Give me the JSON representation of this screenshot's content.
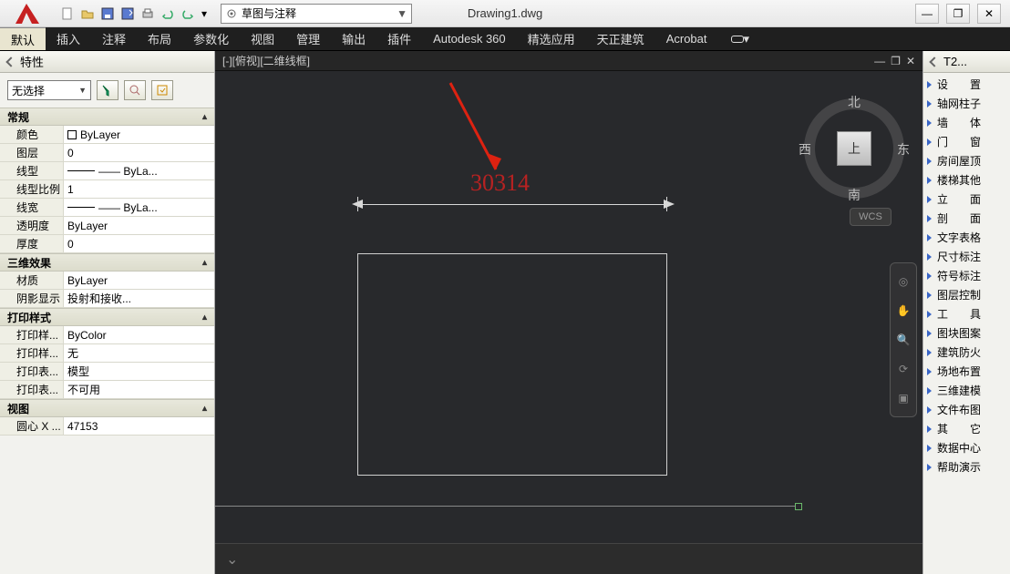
{
  "titlebar": {
    "doc": "Drawing1.dwg"
  },
  "qat_icons": [
    "new",
    "open",
    "save",
    "saveas",
    "plot",
    "undo",
    "redo"
  ],
  "workspace": {
    "label": "草图与注释"
  },
  "win": {
    "min": "—",
    "max": "❐",
    "close": "✕"
  },
  "menus": [
    "默认",
    "插入",
    "注释",
    "布局",
    "参数化",
    "视图",
    "管理",
    "输出",
    "插件",
    "Autodesk 360",
    "精选应用",
    "天正建筑",
    "Acrobat"
  ],
  "props": {
    "panel_title": "特性",
    "selection": "无选择",
    "sections": [
      {
        "name": "常规",
        "rows": [
          {
            "k": "颜色",
            "v": "ByLayer",
            "swatch": true
          },
          {
            "k": "图层",
            "v": "0"
          },
          {
            "k": "线型",
            "v": "—— ByLa...",
            "line": true
          },
          {
            "k": "线型比例",
            "v": "1"
          },
          {
            "k": "线宽",
            "v": "—— ByLa...",
            "line": true
          },
          {
            "k": "透明度",
            "v": "ByLayer"
          },
          {
            "k": "厚度",
            "v": "0"
          }
        ]
      },
      {
        "name": "三维效果",
        "rows": [
          {
            "k": "材质",
            "v": "ByLayer"
          },
          {
            "k": "阴影显示",
            "v": "投射和接收..."
          }
        ]
      },
      {
        "name": "打印样式",
        "rows": [
          {
            "k": "打印样...",
            "v": "ByColor"
          },
          {
            "k": "打印样...",
            "v": "无"
          },
          {
            "k": "打印表...",
            "v": "模型"
          },
          {
            "k": "打印表...",
            "v": "不可用"
          }
        ]
      },
      {
        "name": "视图",
        "rows": [
          {
            "k": "圆心 X ...",
            "v": "47153"
          }
        ]
      }
    ]
  },
  "canvas": {
    "tab_label": "[-][俯视][二维线框]",
    "dimension": "30314",
    "viewcube": {
      "top": "上",
      "n": "北",
      "s": "南",
      "e": "东",
      "w": "西"
    },
    "wcs": "WCS"
  },
  "right": {
    "title": "T2...",
    "items": [
      "设　　置",
      "轴网柱子",
      "墙　　体",
      "门　　窗",
      "房间屋顶",
      "楼梯其他",
      "立　　面",
      "剖　　面",
      "文字表格",
      "尺寸标注",
      "符号标注",
      "图层控制",
      "工　　具",
      "图块图案",
      "建筑防火",
      "场地布置",
      "三维建模",
      "文件布图",
      "其　　它",
      "数据中心",
      "帮助演示"
    ]
  }
}
